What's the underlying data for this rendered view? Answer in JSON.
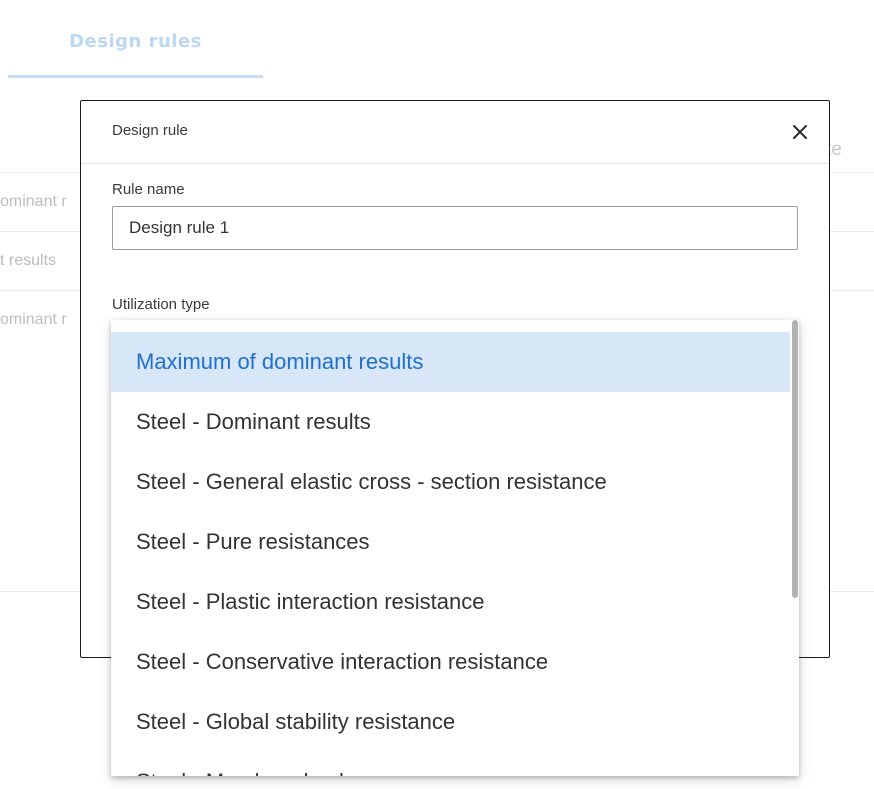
{
  "background": {
    "tab_label": "Design rules",
    "header_trailing_text": "te",
    "rows": [
      {
        "cell": "ominant r"
      },
      {
        "cell": "t results"
      },
      {
        "cell": "ominant r"
      }
    ]
  },
  "dialog": {
    "title": "Design rule",
    "close_icon": "close-icon",
    "rule_name": {
      "label": "Rule name",
      "value": "Design rule 1"
    },
    "utilization_type": {
      "label": "Utilization type",
      "selected": "Maximum of dominant results",
      "options": [
        "Maximum of dominant results",
        "Steel - Dominant results",
        "Steel - General elastic cross - section resistance",
        "Steel - Pure resistances",
        "Steel - Plastic interaction resistance",
        "Steel - Conservative interaction resistance",
        "Steel - Global stability resistance",
        "Steel - Member checks"
      ]
    }
  },
  "colors": {
    "accent": "#1f6fce",
    "selected_bg": "#d7e7f7",
    "tab_faded": "#bcd7f2"
  }
}
